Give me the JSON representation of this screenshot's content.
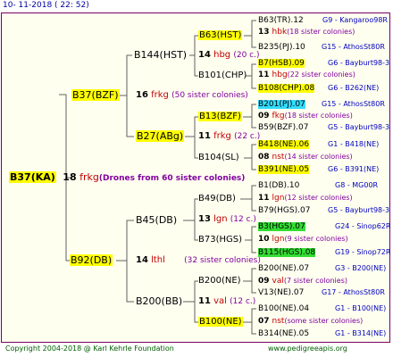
{
  "header": {
    "date": "10- 11-2018 ( 22: 52)"
  },
  "footer": {
    "copyright": "Copyright 2004-2018 @ Karl Kehrle Foundation",
    "site": "www.pedigreeapis.org"
  },
  "root": {
    "label": "B37(KA)",
    "num": "18",
    "code": "frkg",
    "note": "(Drones from 60 sister colonies)"
  },
  "queen_line": {
    "label": "B37(BZF)",
    "num": "16",
    "code": "frkg",
    "note": "(50 sister colonies)"
  },
  "drone_line": {
    "label": "B92(DB)",
    "num": "14",
    "code": "lthl",
    "note": "(32 sister colonies)"
  },
  "gen3": {
    "b144": {
      "label": "B144(HST)"
    },
    "b27": {
      "label": "B27(ABg)",
      "num": "11",
      "code": "frkg",
      "note": "(22 c.)"
    },
    "b45": {
      "label": "B45(DB)"
    },
    "b200": {
      "label": "B200(BB)",
      "num": "11",
      "code": "val",
      "note": "(12 c.)"
    }
  },
  "gen4": [
    {
      "label": "B63(HST)",
      "num": "14",
      "code": "hbg",
      "note": "(20 c.)"
    },
    {
      "label": "B101(CHP)"
    },
    {
      "label": "B13(BZF)",
      "num": "11",
      "code": "frkg",
      "note": "(22 c.)"
    },
    {
      "label": "B104(SL)"
    },
    {
      "label": "B49(DB)"
    },
    {
      "label": "B73(HGS)",
      "num": "13",
      "code": "lgn",
      "note": "(12 c.)"
    },
    {
      "label": "B200(NE)",
      "num": "11",
      "code": "val",
      "note": "(12 c.)"
    },
    {
      "label": "B100(NE)"
    }
  ],
  "leaves": [
    {
      "left": "B63(TR).12",
      "right": "G9 - Kangaroo98R"
    },
    {
      "num": "13",
      "code": "hbk",
      "note": "(18 sister colonies)"
    },
    {
      "left": "B235(PJ).10",
      "right": "G15 - AthosSt80R"
    },
    {
      "left": "B7(HSB).09",
      "right": "G6 - Bayburt98-3"
    },
    {
      "num": "11",
      "code": "hbg",
      "note": "(22 sister colonies)"
    },
    {
      "left": "B108(CHP).08",
      "right": "G6 - B262(NE)"
    },
    {
      "left": "B201(PJ).07",
      "right": "G15 - AthosSt80R"
    },
    {
      "num": "09",
      "code": "fkg",
      "note": "(18 sister colonies)"
    },
    {
      "left": "B59(BZF).07",
      "right": "G5 - Bayburt98-3"
    },
    {
      "left": "B418(NE).06",
      "right": "G1 - B418(NE)"
    },
    {
      "num": "08",
      "code": "nst",
      "note": "(14 sister colonies)"
    },
    {
      "left": "B391(NE).05",
      "right": "G6 - B391(NE)"
    },
    {
      "left": "B1(DB).10",
      "right": "G8 - MG00R"
    },
    {
      "num": "11",
      "code": "lgn",
      "note": "(12 sister colonies)"
    },
    {
      "left": "B79(HGS).07",
      "right": "G5 - Bayburt98-3"
    },
    {
      "left": "B3(HGS).07",
      "right": "G24 - Sinop62R"
    },
    {
      "num": "10",
      "code": "lgn",
      "note": "(9 sister colonies)"
    },
    {
      "left": "B115(HGS).08",
      "right": "G19 - Sinop72R"
    },
    {
      "left": "B200(NE).07",
      "right": "G3 - B200(NE)"
    },
    {
      "num": "09",
      "code": "val",
      "note": "(7 sister colonies)"
    },
    {
      "left": "V13(NE).07",
      "right": "G17 - AthosSt80R"
    },
    {
      "left": "B100(NE).04",
      "right": "G1 - B100(NE)"
    },
    {
      "num": "07",
      "code": "nst",
      "note": "(some sister colonies)"
    },
    {
      "left": "B314(NE).05",
      "right": "G1 - B314(NE)"
    }
  ],
  "colors": {
    "yellow": "#ffff00",
    "green": "#33dd33",
    "cyan": "#33ddff",
    "code": "#c00000",
    "note": "#8000a0",
    "right": "#0000c0"
  }
}
